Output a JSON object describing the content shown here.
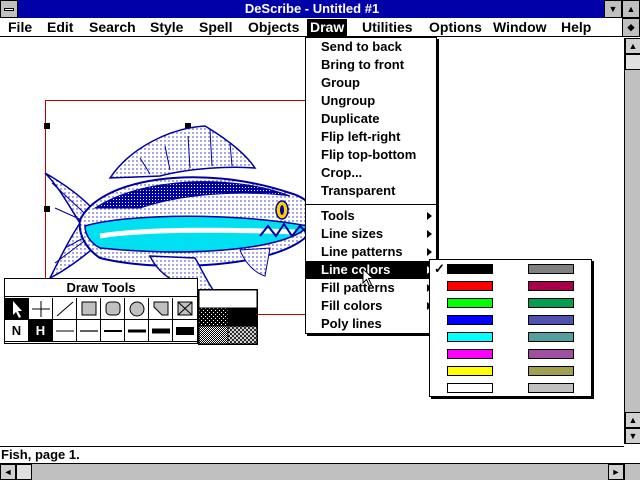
{
  "window": {
    "title": "DeScribe - Untitled #1"
  },
  "menubar": {
    "items": [
      {
        "label": "File"
      },
      {
        "label": "Edit"
      },
      {
        "label": "Search"
      },
      {
        "label": "Style"
      },
      {
        "label": "Spell"
      },
      {
        "label": "Objects"
      },
      {
        "label": "Draw"
      },
      {
        "label": "Utilities"
      },
      {
        "label": "Options"
      },
      {
        "label": "Window"
      },
      {
        "label": "Help"
      }
    ],
    "active": "Draw"
  },
  "draw_menu": {
    "group1": [
      {
        "label": "Send to back"
      },
      {
        "label": "Bring to front"
      },
      {
        "label": "Group"
      },
      {
        "label": "Ungroup"
      },
      {
        "label": "Duplicate"
      },
      {
        "label": "Flip left-right"
      },
      {
        "label": "Flip top-bottom"
      },
      {
        "label": "Crop..."
      },
      {
        "label": "Transparent"
      }
    ],
    "group2": [
      {
        "label": "Tools",
        "submenu": true
      },
      {
        "label": "Line sizes",
        "submenu": true
      },
      {
        "label": "Line patterns",
        "submenu": true
      },
      {
        "label": "Line colors",
        "submenu": true,
        "highlighted": true
      },
      {
        "label": "Fill patterns",
        "submenu": true
      },
      {
        "label": "Fill colors",
        "submenu": true
      },
      {
        "label": "Poly lines"
      }
    ]
  },
  "line_colors_submenu": {
    "checked_index": 0,
    "check_glyph": "✓",
    "left_colors": [
      "#000000",
      "#ff0000",
      "#00ff00",
      "#0000ff",
      "#00ffff",
      "#ff00ff",
      "#ffff00",
      "#ffffff"
    ],
    "right_colors": [
      "#808080",
      "#a8004a",
      "#00a050",
      "#5050b0",
      "#50a0a0",
      "#a050a0",
      "#a0a050",
      "#c0c0c0"
    ]
  },
  "draw_tools": {
    "title": "Draw Tools",
    "row1_icons": [
      "pointer-icon",
      "crosshair-icon",
      "line-icon",
      "rectangle-icon",
      "rounded-rect-icon",
      "ellipse-icon",
      "polygon-icon",
      "frame-icon"
    ],
    "row2": [
      {
        "label": "N"
      },
      {
        "label": "H",
        "selected": true
      }
    ]
  },
  "status": {
    "text": "Fish, page 1."
  },
  "colors": {
    "titlebar": "#0000a8",
    "menu_highlight": "#000000",
    "fish_outline": "#0000a0",
    "fish_cyan": "#00e0f0"
  }
}
